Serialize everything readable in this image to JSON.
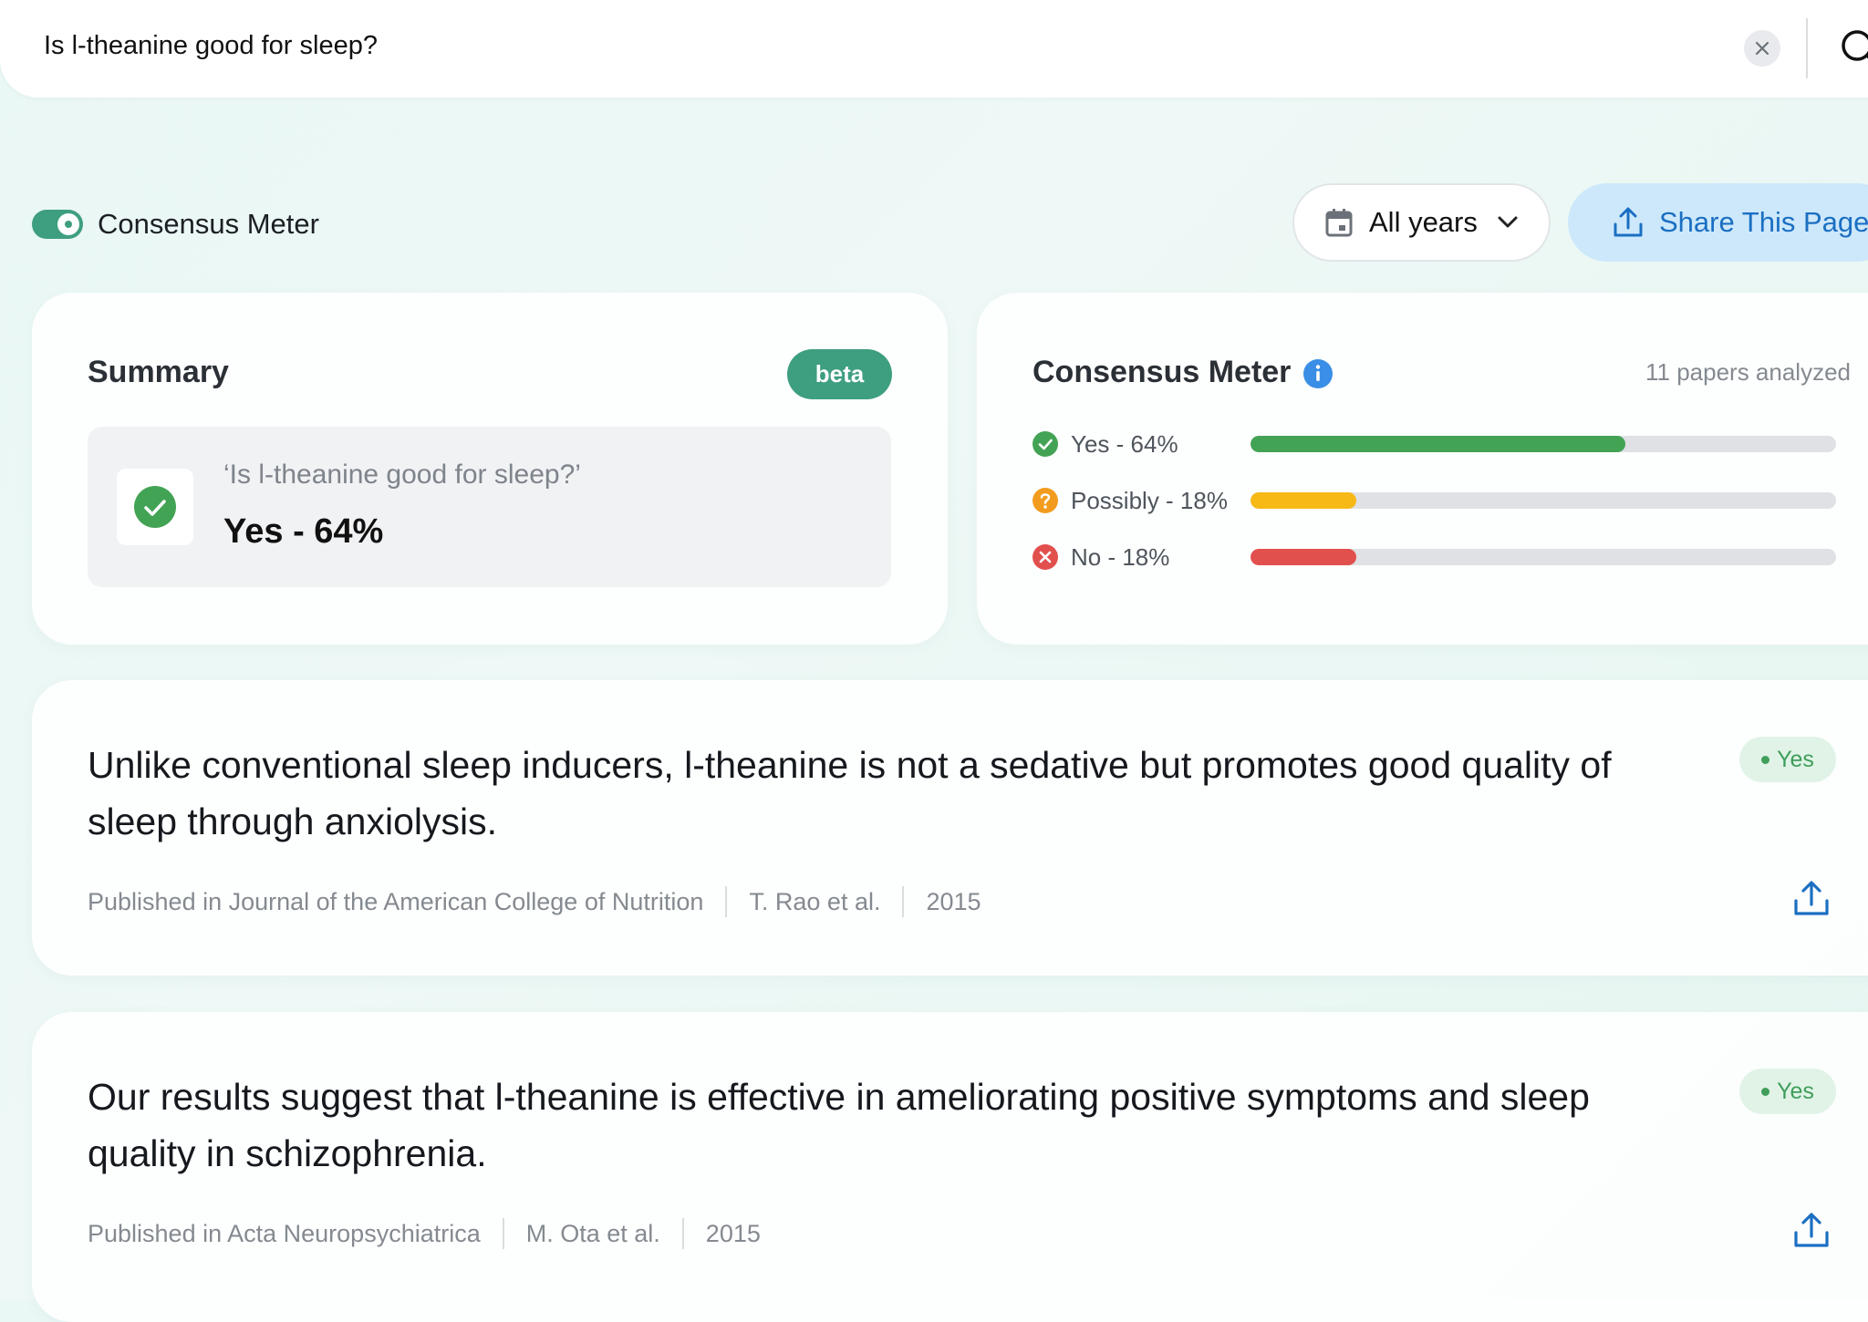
{
  "search": {
    "query": "Is l-theanine good for sleep?"
  },
  "toolbar": {
    "toggle_label": "Consensus Meter",
    "years_label": "All years",
    "share_label": "Share This Page"
  },
  "summary": {
    "title": "Summary",
    "badge": "beta",
    "question": "‘Is l-theanine good for sleep?’",
    "answer": "Yes - 64%"
  },
  "meter": {
    "title": "Consensus Meter",
    "papers": "11 papers analyzed",
    "rows": [
      {
        "label": "Yes - 64%",
        "percent": 64,
        "color": "#43a355"
      },
      {
        "label": "Possibly - 18%",
        "percent": 18,
        "color": "#f6b916"
      },
      {
        "label": "No - 18%",
        "percent": 18,
        "color": "#e2504e"
      }
    ]
  },
  "results": [
    {
      "claim": "Unlike conventional sleep inducers, l-theanine is not a sedative but promotes good quality of sleep through anxiolysis.",
      "badge": "Yes",
      "journal": "Published in Journal of the American College of Nutrition",
      "authors": "T. Rao et al.",
      "year": "2015"
    },
    {
      "claim": "Our results suggest that l-theanine is effective in ameliorating positive symptoms and sleep quality in schizophrenia.",
      "badge": "Yes",
      "journal": "Published in Acta Neuropsychiatrica",
      "authors": "M. Ota et al.",
      "year": "2015"
    }
  ]
}
